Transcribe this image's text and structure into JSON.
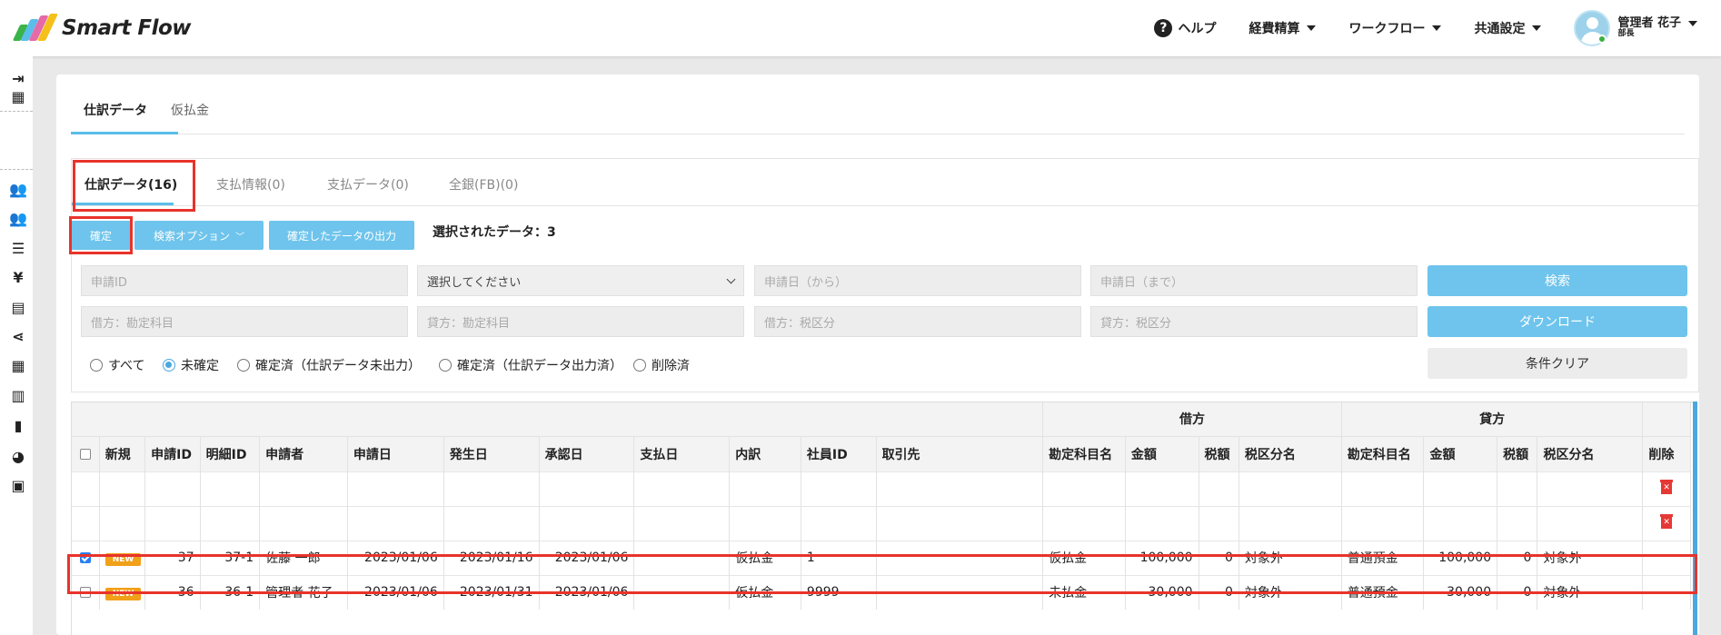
{
  "app": {
    "name": "Smart Flow"
  },
  "header": {
    "help": "ヘルプ",
    "menus": [
      "経費精算",
      "ワークフロー",
      "共通設定"
    ],
    "user": {
      "name": "管理者 花子",
      "role": "部長"
    }
  },
  "top_tabs": [
    "仕訳データ",
    "仮払金"
  ],
  "sub_tabs": [
    "仕訳データ(16)",
    "支払情報(0)",
    "支払データ(0)",
    "全銀(FB)(0)"
  ],
  "actions": {
    "confirm": "確定",
    "search_options": "検索オプション",
    "export_confirmed": "確定したデータの出力",
    "selected_label": "選択されたデータ：3"
  },
  "filters": {
    "request_id": "申請ID",
    "select_placeholder": "選択してください",
    "date_from": "申請日（から）",
    "date_to": "申請日（まで）",
    "debit_account": "借方：勘定科目",
    "credit_account": "貸方：勘定科目",
    "debit_tax": "借方：税区分",
    "credit_tax": "貸方：税区分",
    "search": "検索",
    "download": "ダウンロード",
    "clear": "条件クリア"
  },
  "status_options": [
    {
      "label": "すべて",
      "checked": false
    },
    {
      "label": "未確定",
      "checked": true
    },
    {
      "label": "確定済（仕訳データ未出力）",
      "checked": false
    },
    {
      "label": "確定済（仕訳データ出力済）",
      "checked": false
    },
    {
      "label": "削除済",
      "checked": false
    }
  ],
  "table": {
    "group_headers": {
      "debit": "借方",
      "credit": "貸方"
    },
    "columns": [
      "新規",
      "申請ID",
      "明細ID",
      "申請者",
      "申請日",
      "発生日",
      "承認日",
      "支払日",
      "内訳",
      "社員ID",
      "取引先",
      "勘定科目名",
      "金額",
      "税額",
      "税区分名",
      "勘定科目名",
      "金額",
      "税額",
      "税区分名",
      "削除"
    ],
    "rows": [
      {
        "checked": true,
        "new": "NEW",
        "request_id": "37",
        "detail_id": "37-1",
        "applicant": "佐藤 一郎",
        "apply_date": "2023/01/06",
        "occur_date": "2023/01/16",
        "approve_date": "2023/01/06",
        "pay_date": "",
        "breakdown": "仮払金",
        "employee_id": "1",
        "partner": "",
        "debit_account": "仮払金",
        "debit_amount": "100,000",
        "debit_tax": "0",
        "debit_tax_class": "対象外",
        "credit_account": "普通預金",
        "credit_amount": "100,000",
        "credit_tax": "0",
        "credit_tax_class": "対象外"
      },
      {
        "checked": false,
        "new": "NEW",
        "request_id": "36",
        "detail_id": "36-1",
        "applicant": "管理者 花子",
        "apply_date": "2023/01/06",
        "occur_date": "2023/01/31",
        "approve_date": "2023/01/06",
        "pay_date": "",
        "breakdown": "仮払金",
        "employee_id": "9999",
        "partner": "",
        "debit_account": "未払金",
        "debit_amount": "30,000",
        "debit_tax": "0",
        "debit_tax_class": "対象外",
        "credit_account": "普通預金",
        "credit_amount": "30,000",
        "credit_tax": "0",
        "credit_tax_class": "対象外"
      }
    ]
  },
  "colors": {
    "accent": "#6ec4ec",
    "highlight": "#e8332b",
    "badge": "#f0a019",
    "delete": "#e53935"
  }
}
